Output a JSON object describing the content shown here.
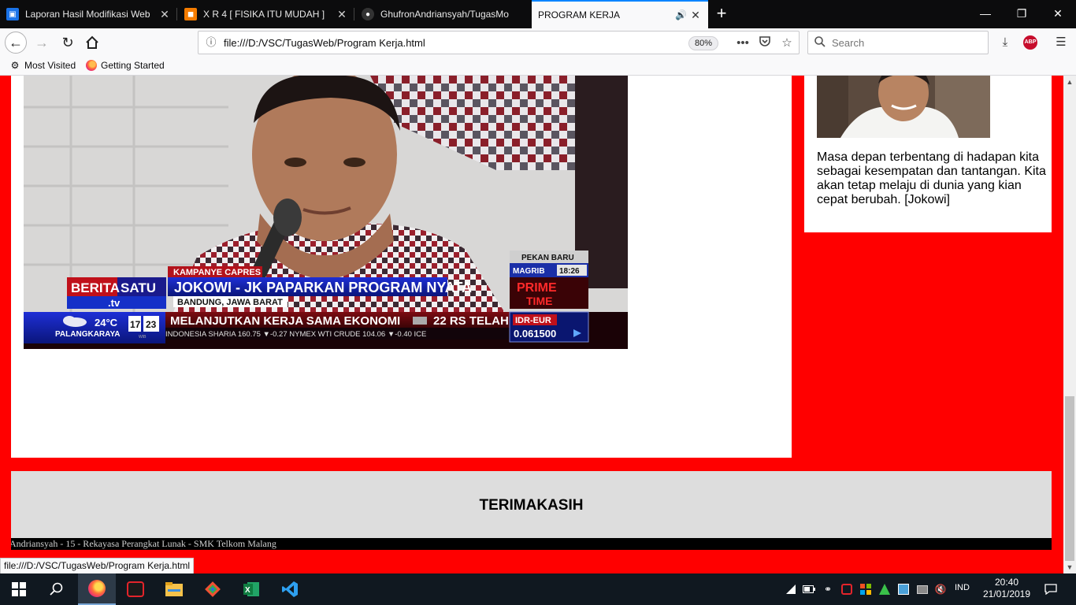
{
  "browser": {
    "tabs": [
      {
        "title": "Laporan Hasil Modifikasi Web",
        "icon": "document-icon",
        "active": false
      },
      {
        "title": "X R 4 [ FISIKA ITU MUDAH ]",
        "icon": "classroom-icon",
        "active": false
      },
      {
        "title": "GhufronAndriansyah/TugasMo",
        "icon": "github-icon",
        "active": false
      },
      {
        "title": "PROGRAM KERJA",
        "icon": "speaker-icon",
        "active": true
      }
    ],
    "url": "file:///D:/VSC/TugasWeb/Program Kerja.html",
    "zoom": "80%",
    "search_placeholder": "Search",
    "bookmarks": [
      {
        "label": "Most Visited",
        "icon": "gear-icon"
      },
      {
        "label": "Getting Started",
        "icon": "firefox-icon"
      }
    ],
    "abp_label": "ABP",
    "status_link": "file:///D:/VSC/TugasWeb/Program Kerja.html"
  },
  "page": {
    "video_overlay": {
      "brand_top": "BERITA",
      "brand_top2": "SATU",
      "brand_tv": ".tv",
      "tag": "KAMPANYE CAPRES",
      "headline": "JOKOWI - JK PAPARKAN PROGRAM NYATA",
      "location": "BANDUNG, JAWA BARAT",
      "city_top": "PEKAN BARU",
      "prayer": "MAGRIB",
      "prayer_time": "18:26",
      "prime1": "PRIME",
      "prime2": "TIME",
      "weather_temp": "24°C",
      "weather_city": "PALANGKARAYA",
      "clock_h": "17",
      "clock_m": "23",
      "clock_zone": "WIB",
      "ticker": "MELANJUTKAN KERJA SAMA EKONOMI",
      "ticker2": "22 RS TELAH",
      "market_line": "INDONESIA SHARIA  160.75 ▼-0.27     NYMEX WTI CRUDE  104.06 ▼-0.40     ICE",
      "fx_label": "IDR-EUR",
      "fx_value": "0.061500"
    },
    "quote": "Masa depan terbentang di hadapan kita sebagai kesempatan dan tantangan. Kita akan tetap melaju di dunia yang kian cepat berubah. [Jokowi]",
    "footer_title": "TERIMAKASIH",
    "credits": "Andriansyah - 15 - Rekayasa Perangkat Lunak - SMK Telkom Malang"
  },
  "taskbar": {
    "apps": [
      "windows-start-icon",
      "search-icon",
      "firefox-icon",
      "garena-icon",
      "file-explorer-icon",
      "git-icon",
      "excel-icon",
      "vscode-icon"
    ],
    "language": "IND",
    "time": "20:40",
    "date": "21/01/2019"
  }
}
